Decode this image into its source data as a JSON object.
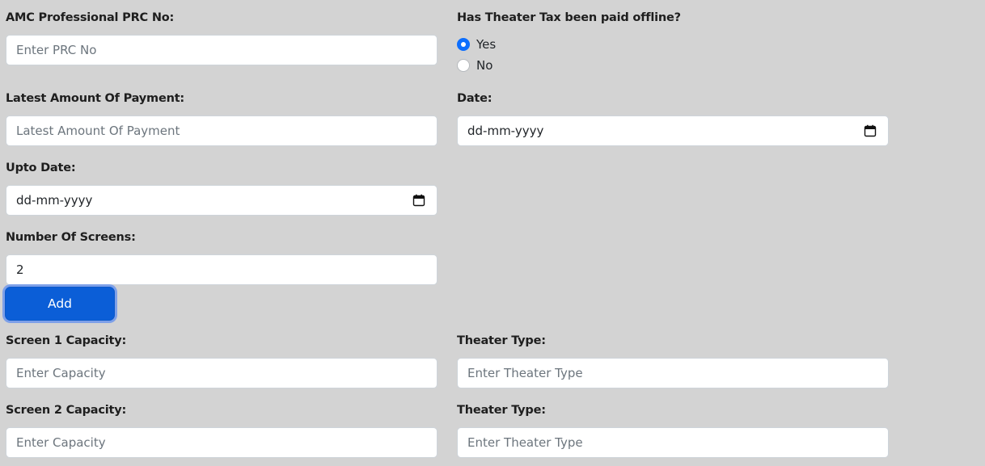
{
  "form": {
    "prc": {
      "label": "AMC Professional PRC No:",
      "placeholder": "Enter PRC No",
      "value": ""
    },
    "theater_tax": {
      "label": "Has Theater Tax been paid offline?",
      "options": [
        {
          "label": "Yes",
          "checked": true
        },
        {
          "label": "No",
          "checked": false
        }
      ]
    },
    "latest_amount": {
      "label": "Latest Amount Of Payment:",
      "placeholder": "Latest Amount Of Payment",
      "value": ""
    },
    "date": {
      "label": "Date:",
      "value": "dd-mm-yyyy"
    },
    "upto_date": {
      "label": "Upto Date:",
      "value": "dd-mm-yyyy"
    },
    "num_screens": {
      "label": "Number Of Screens:",
      "value": "2"
    },
    "add_button": {
      "label": "Add"
    },
    "screens": [
      {
        "capacity_label": "Screen 1 Capacity:",
        "capacity_placeholder": "Enter Capacity",
        "type_label": "Theater Type:",
        "type_placeholder": "Enter Theater Type"
      },
      {
        "capacity_label": "Screen 2 Capacity:",
        "capacity_placeholder": "Enter Capacity",
        "type_label": "Theater Type:",
        "type_placeholder": "Enter Theater Type"
      }
    ]
  },
  "colors": {
    "background": "#d3d3d3",
    "primary": "#0b5ed7",
    "radio_checked": "#0d6efd"
  },
  "icons": {
    "date_picker": "calendar-icon"
  }
}
